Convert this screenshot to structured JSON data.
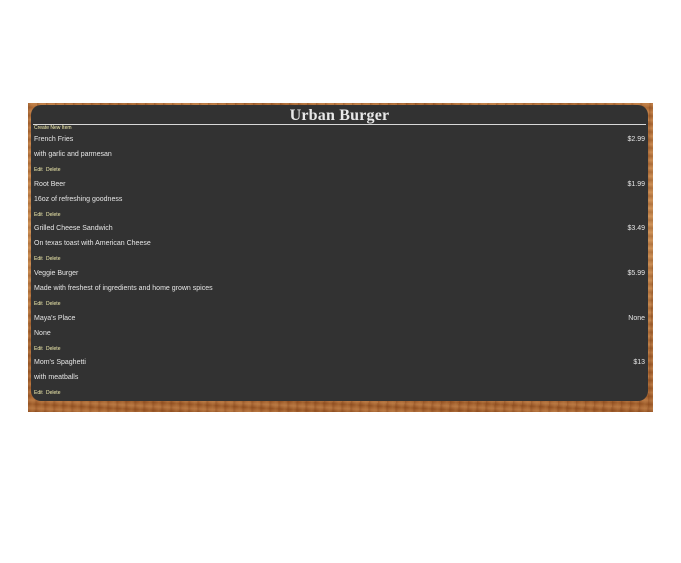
{
  "restaurant": {
    "name": "Urban Burger"
  },
  "actions": {
    "create_label": "Create New Item",
    "edit_label": "Edit",
    "delete_label": "Delete"
  },
  "menu_items": [
    {
      "name": "French Fries",
      "price": "$2.99",
      "description": "with garlic and parmesan"
    },
    {
      "name": "Root Beer",
      "price": "$1.99",
      "description": "16oz of refreshing goodness"
    },
    {
      "name": "Grilled Cheese Sandwich",
      "price": "$3.49",
      "description": "On texas toast with American Cheese"
    },
    {
      "name": "Veggie Burger",
      "price": "$5.99",
      "description": "Made with freshest of ingredients and home grown spices"
    },
    {
      "name": "Maya's Place",
      "price": "None",
      "description": "None"
    },
    {
      "name": "Mom's Spaghetti",
      "price": "$13",
      "description": "with meatballs"
    }
  ]
}
